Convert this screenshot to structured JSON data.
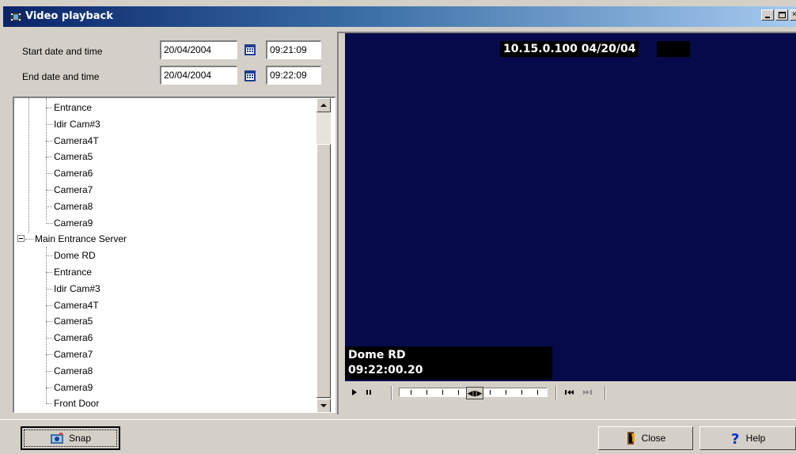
{
  "window": {
    "title": "Video playback",
    "icon": "film-icon",
    "controls": [
      "minimize-icon",
      "maximize-icon",
      "close-icon"
    ]
  },
  "filters": {
    "start_label": "Start date and time",
    "start_date": "20/04/2004",
    "start_time": "09:21:09",
    "end_label": "End date and time",
    "end_date": "20/04/2004",
    "end_time": "09:22:09"
  },
  "tree": {
    "items": [
      "Entrance",
      "Idir Cam#3",
      "Camera4T",
      "Camera5",
      "Camera6",
      "Camera7",
      "Camera8",
      "Camera9",
      "Main Entrance Server",
      "Dome RD",
      "Entrance",
      "Idir Cam#3",
      "Camera4T",
      "Camera5",
      "Camera6",
      "Camera7",
      "Camera8",
      "Camera9",
      "Front Door"
    ]
  },
  "video": {
    "overlay_top": "10.15.0.100 04/20/04",
    "overlay_camera": "Dome RD",
    "overlay_time": "09:22:00.20",
    "background": "#060a4a",
    "position_fraction": 0.5
  },
  "buttons": {
    "snap": "Snap",
    "close": "Close",
    "help": "Help"
  },
  "colors": {
    "title_start": "#0a246a",
    "title_end": "#a6caf0",
    "face": "#d4d0c8"
  }
}
